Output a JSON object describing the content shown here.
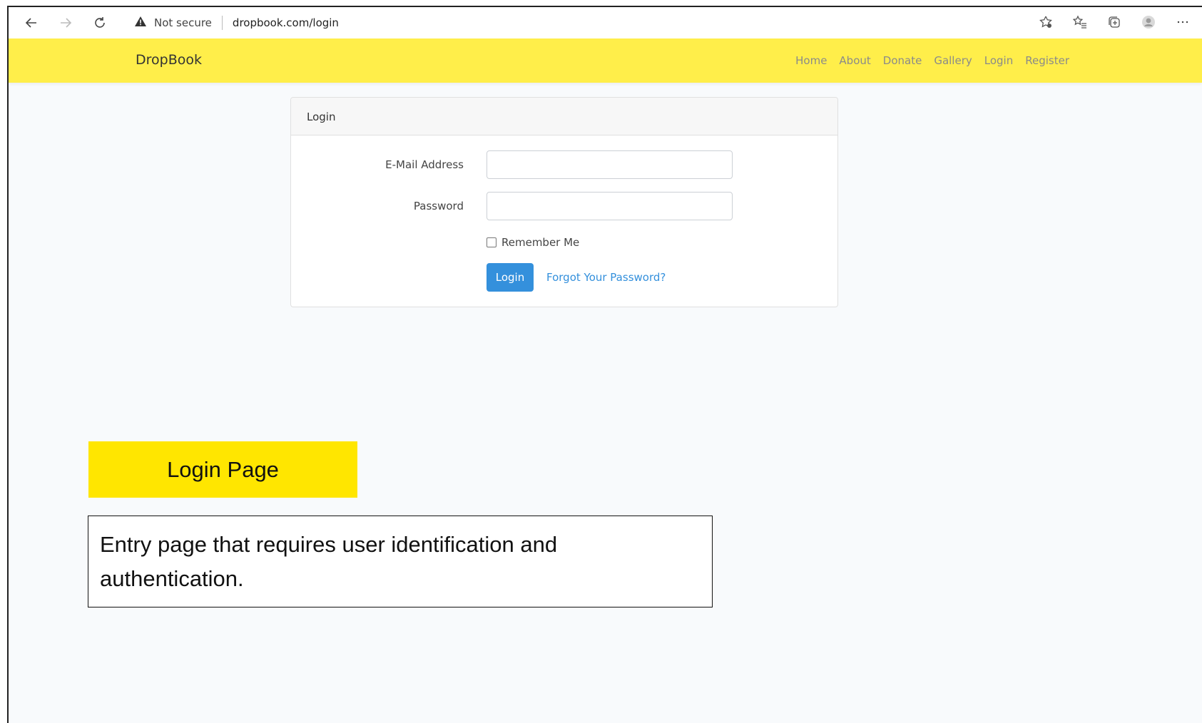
{
  "browser": {
    "security_label": "Not secure",
    "url": "dropbook.com/login"
  },
  "site": {
    "brand": "DropBook",
    "nav": [
      "Home",
      "About",
      "Donate",
      "Gallery",
      "Login",
      "Register"
    ]
  },
  "login_card": {
    "header": "Login",
    "email_label": "E-Mail Address",
    "email_value": "",
    "password_label": "Password",
    "password_value": "",
    "remember_label": "Remember Me",
    "submit_label": "Login",
    "forgot_label": "Forgot Your Password?"
  },
  "annotation": {
    "title": "Login Page",
    "description": "Entry page that requires user identification and authentication."
  },
  "colors": {
    "navbar": "#ffee4a",
    "primary": "#3490dc",
    "annotation_highlight": "#ffe600"
  }
}
